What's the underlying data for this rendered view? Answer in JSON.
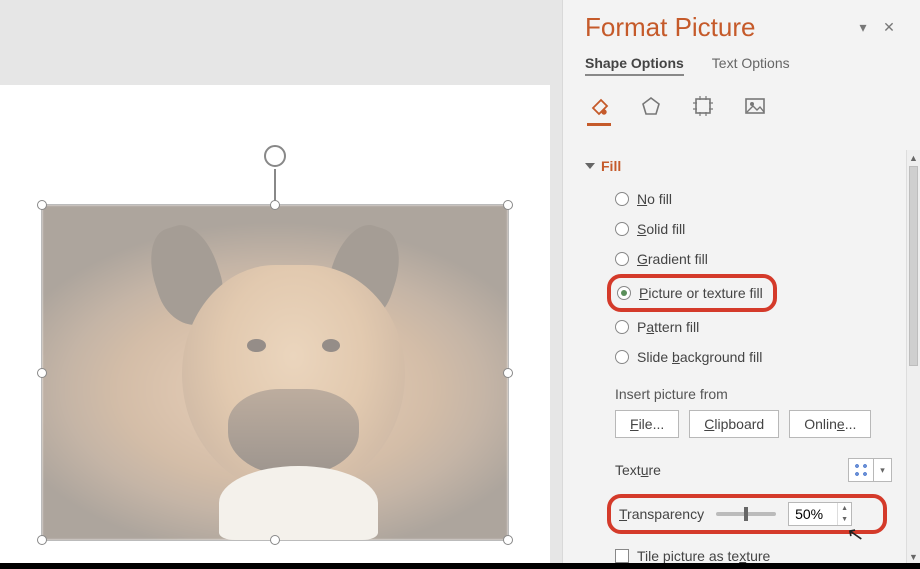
{
  "panel": {
    "title": "Format Picture",
    "tabs": {
      "shape": "Shape Options",
      "text": "Text Options",
      "active": "shape"
    }
  },
  "fill": {
    "section_label": "Fill",
    "options": {
      "none": {
        "label_pre": "",
        "key": "N",
        "label_post": "o fill"
      },
      "solid": {
        "label_pre": "",
        "key": "S",
        "label_post": "olid fill"
      },
      "grad": {
        "label_pre": "",
        "key": "G",
        "label_post": "radient fill"
      },
      "pic": {
        "label_pre": "",
        "key": "P",
        "label_post": "icture or texture fill"
      },
      "pat": {
        "label_pre": "P",
        "key": "a",
        "label_post": "ttern fill"
      },
      "bg": {
        "label_pre": "Slide ",
        "key": "b",
        "label_post": "ackground fill"
      }
    },
    "selected": "pic"
  },
  "insert": {
    "header": "Insert picture from",
    "file": {
      "key": "F",
      "post": "ile..."
    },
    "clip": {
      "key": "C",
      "post": "lipboard"
    },
    "online": {
      "pre": "Onlin",
      "key": "e",
      "post": "..."
    }
  },
  "texture": {
    "label_pre": "Text",
    "label_key": "u",
    "label_post": "re"
  },
  "transparency": {
    "label_key": "T",
    "label_post": "ransparency",
    "value": "50%",
    "slider_pct": 50
  },
  "tile": {
    "label_pre": "Tile picture as te",
    "key": "x",
    "label_post": "ture",
    "checked": false
  }
}
